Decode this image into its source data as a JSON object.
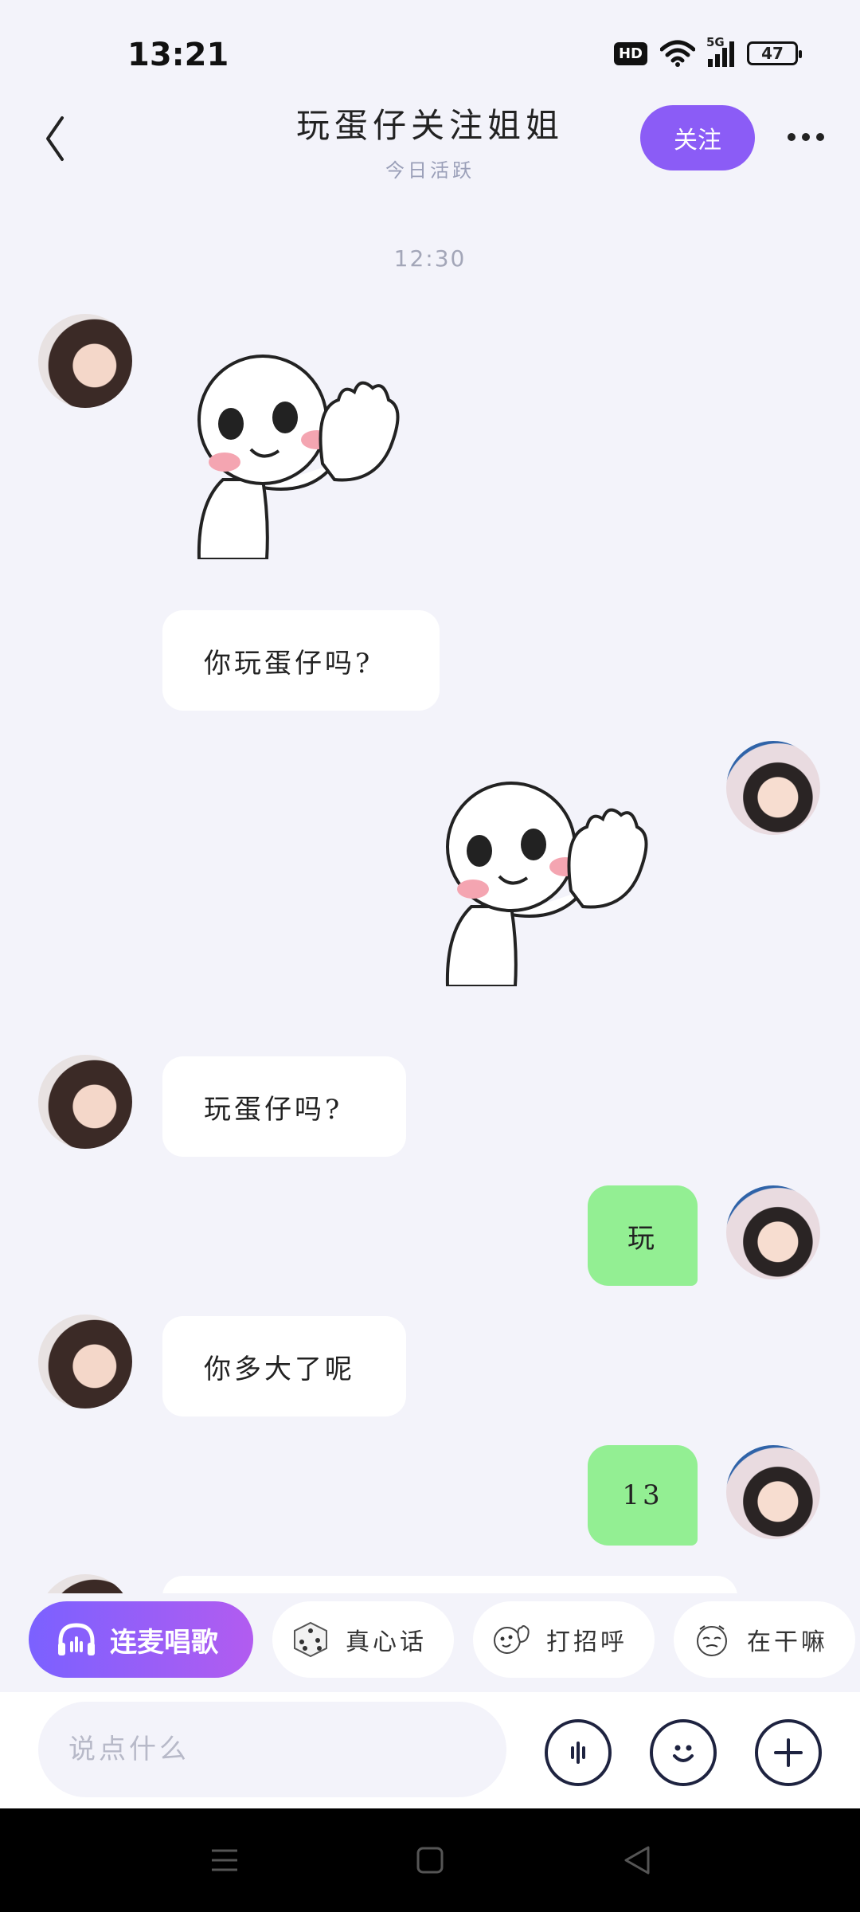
{
  "status_bar": {
    "time": "13:21",
    "hd_label": "HD",
    "network_label": "5G",
    "battery_level": "47"
  },
  "header": {
    "title": "玩蛋仔关注姐姐",
    "subtitle": "今日活跃",
    "follow_label": "关注"
  },
  "chat": {
    "timestamp": "12:30",
    "messages": [
      {
        "side": "left",
        "type": "sticker",
        "sticker": "waving-man-sticker"
      },
      {
        "side": "left",
        "type": "text",
        "text": "你玩蛋仔吗?"
      },
      {
        "side": "right",
        "type": "sticker",
        "sticker": "waving-man-sticker"
      },
      {
        "side": "left",
        "type": "text",
        "text": "玩蛋仔吗?"
      },
      {
        "side": "right",
        "type": "text",
        "text": "玩"
      },
      {
        "side": "left",
        "type": "text",
        "text": "你多大了呢"
      },
      {
        "side": "right",
        "type": "text",
        "text": "13"
      }
    ]
  },
  "quick_actions": {
    "karaoke": "连麦唱歌",
    "truth": "真心话",
    "greet": "打招呼",
    "doing": "在干嘛"
  },
  "input": {
    "placeholder": "说点什么"
  },
  "colors": {
    "accent": "#8b5cf6",
    "own_bubble": "#93ef93",
    "background": "#f3f3fa"
  }
}
